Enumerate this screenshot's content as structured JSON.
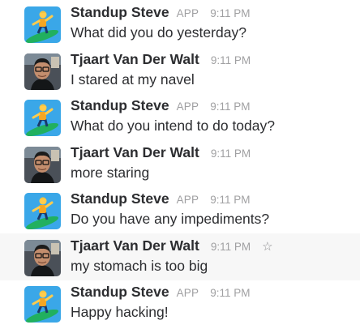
{
  "colors": {
    "author": "#2c2d30",
    "meta": "#a0a0a2",
    "hover_bg": "#f7f7f7",
    "bot_avatar_bg": "#3aa7e8",
    "surfboard": "#21b05f"
  },
  "messages": [
    {
      "author": "Standup Steve",
      "badge": "APP",
      "time": "9:11 PM",
      "text": "What did you do yesterday?",
      "avatar": "surfer-icon"
    },
    {
      "author": "Tjaart Van Der Walt",
      "badge": "",
      "time": "9:11 PM",
      "text": "I stared at my navel",
      "avatar": "user-photo"
    },
    {
      "author": "Standup Steve",
      "badge": "APP",
      "time": "9:11 PM",
      "text": "What do you intend to do today?",
      "avatar": "surfer-icon"
    },
    {
      "author": "Tjaart Van Der Walt",
      "badge": "",
      "time": "9:11 PM",
      "text": "more staring",
      "avatar": "user-photo"
    },
    {
      "author": "Standup Steve",
      "badge": "APP",
      "time": "9:11 PM",
      "text": "Do you have any impediments?",
      "avatar": "surfer-icon"
    },
    {
      "author": "Tjaart Van Der Walt",
      "badge": "",
      "time": "9:11 PM",
      "text": "my stomach is too big",
      "avatar": "user-photo",
      "star_icon": "star-outline-icon"
    },
    {
      "author": "Standup Steve",
      "badge": "APP",
      "time": "9:11 PM",
      "text": "Happy hacking!",
      "avatar": "surfer-icon"
    }
  ]
}
